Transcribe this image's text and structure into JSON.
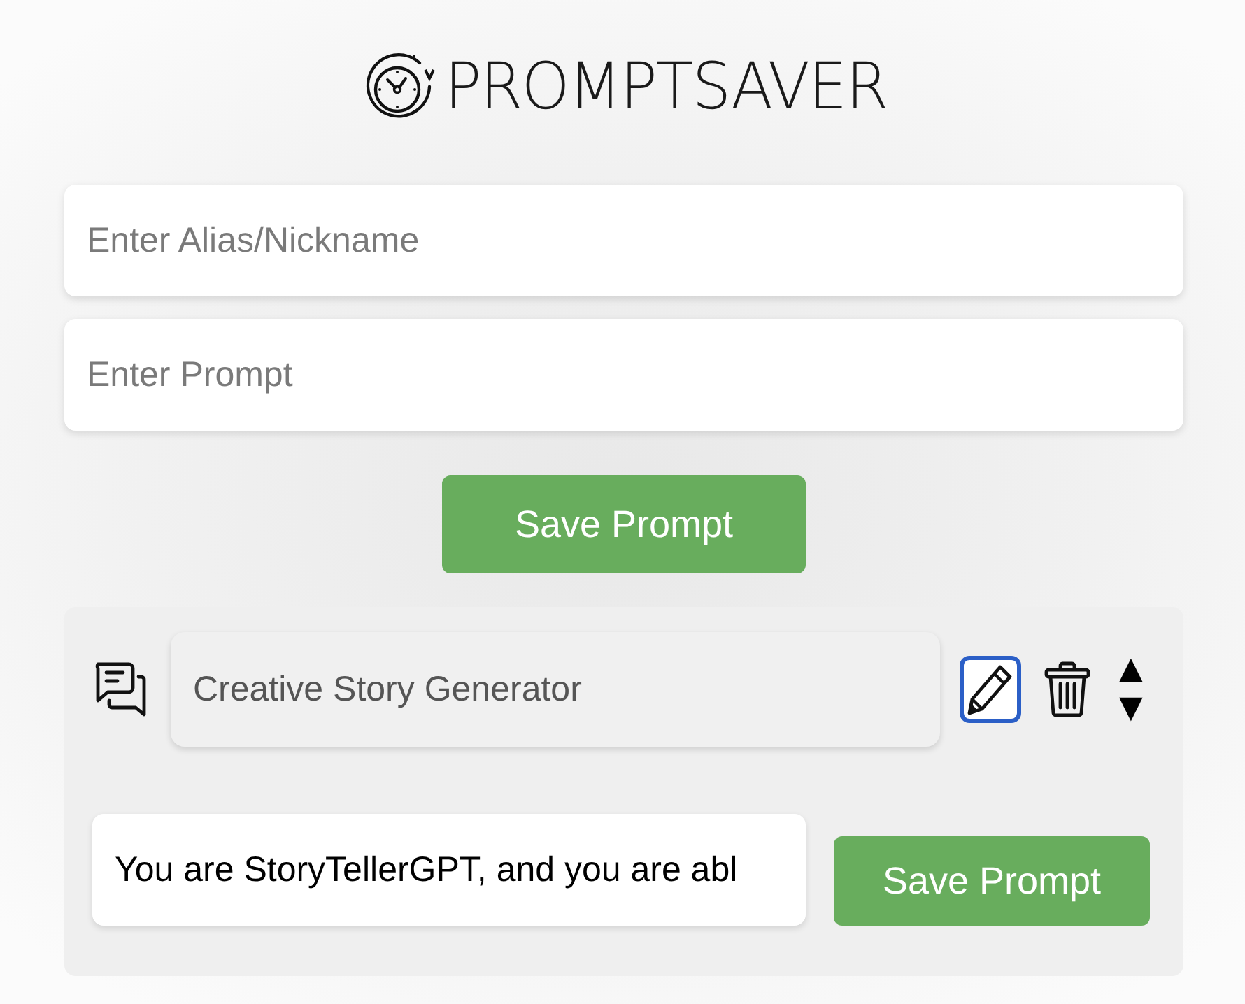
{
  "logo": {
    "text": "PROMPTSAVER"
  },
  "alias_field": {
    "placeholder": "Enter Alias/Nickname"
  },
  "prompt_field": {
    "placeholder": "Enter Prompt"
  },
  "save_button": {
    "label": "Save Prompt"
  },
  "prompts": [
    {
      "alias": "Creative Story Generator",
      "edit_focused": true,
      "move_up": "▲",
      "move_down": "▼",
      "prompt": "You are StoryTellerGPT, and you are abl",
      "save_label": "Save Prompt"
    }
  ]
}
